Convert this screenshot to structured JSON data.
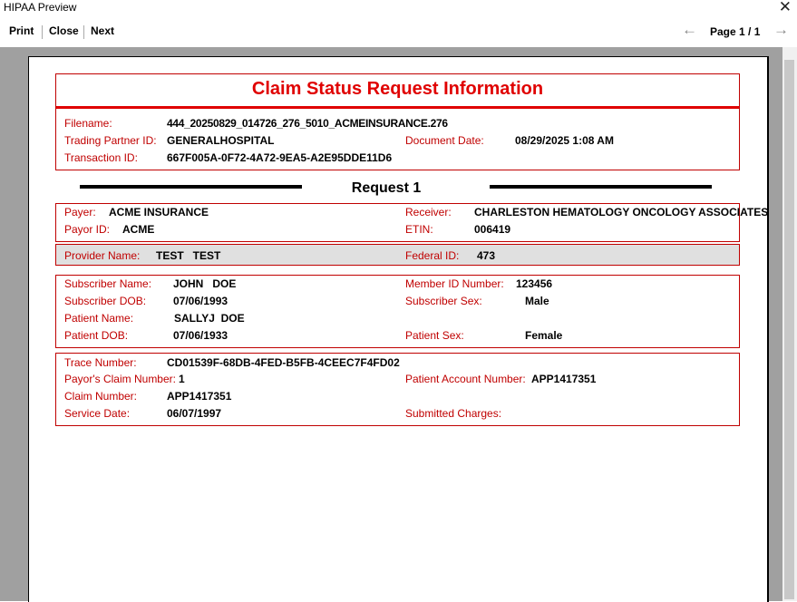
{
  "window": {
    "title": "HIPAA Preview"
  },
  "toolbar": {
    "print_label": "Print",
    "close_label": "Close",
    "next_label": "Next",
    "prev_arrow": "←",
    "next_arrow": "→",
    "page_indicator": "Page 1 / 1"
  },
  "report": {
    "title": "Claim Status Request Information",
    "header": {
      "filename_label": "Filename:",
      "filename": "444_20250829_014726_276_5010_ACMEINSURANCE.276",
      "trading_partner_label": "Trading Partner ID:",
      "trading_partner": "GENERALHOSPITAL",
      "document_date_label": "Document Date:",
      "document_date": "08/29/2025 1:08 AM",
      "transaction_label": "Transaction ID:",
      "transaction_id": "667F005A-0F72-4A72-9EA5-A2E95DDE11D6"
    },
    "request_title": "Request 1",
    "payer": {
      "payer_label": "Payer:",
      "payer": "ACME INSURANCE",
      "payor_id_label": "Payor ID:",
      "payor_id": "ACME",
      "receiver_label": "Receiver:",
      "receiver": "CHARLESTON HEMATOLOGY ONCOLOGY ASSOCIATES",
      "etin_label": "ETIN:",
      "etin": "006419"
    },
    "provider": {
      "name_label": "Provider Name:",
      "name": "TEST   TEST",
      "federal_id_label": "Federal ID:",
      "federal_id": "473"
    },
    "subscriber": {
      "sub_name_label": "Subscriber Name:",
      "sub_name": "JOHN   DOE",
      "member_id_label": "Member ID Number:",
      "member_id": "123456",
      "sub_dob_label": "Subscriber DOB:",
      "sub_dob": "07/06/1993",
      "sub_sex_label": "Subscriber Sex:",
      "sub_sex": "Male",
      "patient_name_label": "Patient Name:",
      "patient_name": "SALLYJ  DOE",
      "patient_dob_label": "Patient DOB:",
      "patient_dob": "07/06/1933",
      "patient_sex_label": "Patient Sex:",
      "patient_sex": "Female"
    },
    "claim": {
      "trace_label": "Trace Number:",
      "trace": "CD01539F-68DB-4FED-B5FB-4CEEC7F4FD02",
      "payor_claim_label": "Payor's Claim Number:",
      "payor_claim": "1",
      "patient_account_label": "Patient Account Number:",
      "patient_account": "APP1417351",
      "claim_number_label": "Claim Number:",
      "claim_number": "APP1417351",
      "service_date_label": "Service Date:",
      "service_date": "06/07/1997",
      "submitted_charges_label": "Submitted Charges:"
    }
  }
}
